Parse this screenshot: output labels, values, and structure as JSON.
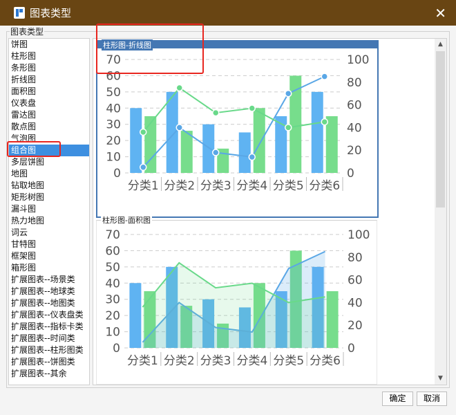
{
  "dialog": {
    "title": "图表类型",
    "close_symbol": "✕",
    "group_label": "图表类型"
  },
  "chart_types": [
    "饼图",
    "柱形图",
    "条形图",
    "折线图",
    "面积图",
    "仪表盘",
    "雷达图",
    "散点图",
    "气泡图",
    "组合图",
    "多层饼图",
    "地图",
    "钻取地图",
    "矩形树图",
    "漏斗图",
    "热力地图",
    "词云",
    "甘特图",
    "框架图",
    "箱形图",
    "扩展图表--场景类",
    "扩展图表--地球类",
    "扩展图表--地图类",
    "扩展图表--仪表盘类",
    "扩展图表--指标卡类",
    "扩展图表--时间类",
    "扩展图表--柱形图类",
    "扩展图表--饼图类",
    "扩展图表--其余"
  ],
  "selected_type": "组合图",
  "buttons": {
    "ok": "确定",
    "cancel": "取消"
  },
  "scrollbar": {
    "up": "▲",
    "down": "▼"
  },
  "colors": {
    "bar_blue": "#5fb3f2",
    "bar_green": "#77dd8c",
    "line_blue": "#5aa7e6",
    "line_green": "#69d98a",
    "selected_bg": "#3d8fe0",
    "title_bar": "#694513",
    "highlight": "#e8261f"
  },
  "chart_data": [
    {
      "type": "bar+line",
      "title": "柱形图-折线图",
      "categories": [
        "分类1",
        "分类2",
        "分类3",
        "分类4",
        "分类5",
        "分类6"
      ],
      "ylim_left": [
        0,
        70
      ],
      "left_ticks": [
        0,
        10,
        20,
        30,
        40,
        50,
        60,
        70
      ],
      "ylim_right": [
        0,
        100
      ],
      "right_ticks": [
        0,
        20,
        40,
        60,
        80,
        100
      ],
      "series": [
        {
          "kind": "bar",
          "axis": "left",
          "values": [
            40,
            50,
            30,
            25,
            35,
            50
          ]
        },
        {
          "kind": "bar",
          "axis": "left",
          "values": [
            35,
            26,
            15,
            40,
            60,
            35
          ]
        },
        {
          "kind": "line",
          "axis": "right",
          "values": [
            5,
            40,
            18,
            14,
            70,
            85
          ]
        },
        {
          "kind": "line",
          "axis": "right",
          "values": [
            36,
            75,
            53,
            57,
            40,
            45
          ]
        }
      ],
      "grid": true
    },
    {
      "type": "bar+area",
      "title": "柱形图-面积图",
      "categories": [
        "分类1",
        "分类2",
        "分类3",
        "分类4",
        "分类5",
        "分类6"
      ],
      "ylim_left": [
        0,
        70
      ],
      "left_ticks": [
        0,
        10,
        20,
        30,
        40,
        50,
        60,
        70
      ],
      "ylim_right": [
        0,
        100
      ],
      "right_ticks": [
        0,
        20,
        40,
        60,
        80,
        100
      ],
      "series": [
        {
          "kind": "bar",
          "axis": "left",
          "values": [
            40,
            50,
            30,
            25,
            35,
            50
          ]
        },
        {
          "kind": "bar",
          "axis": "left",
          "values": [
            35,
            26,
            15,
            40,
            60,
            35
          ]
        },
        {
          "kind": "area",
          "axis": "right",
          "values": [
            5,
            40,
            18,
            14,
            70,
            85
          ]
        },
        {
          "kind": "area",
          "axis": "right",
          "values": [
            36,
            75,
            53,
            57,
            40,
            45
          ]
        }
      ],
      "grid": true
    }
  ]
}
